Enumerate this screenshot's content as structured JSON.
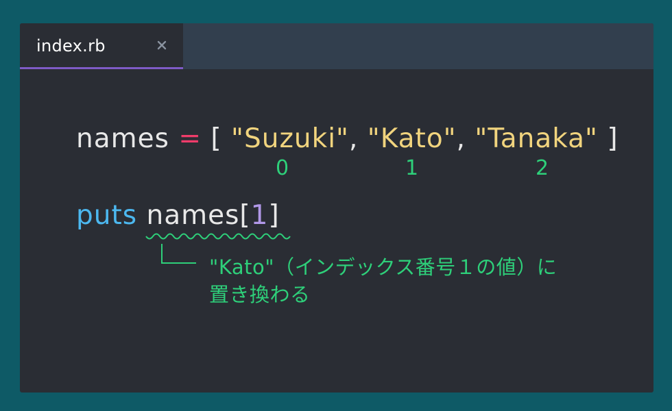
{
  "tab": {
    "title": "index.rb",
    "close_glyph": "×"
  },
  "code": {
    "line1": {
      "var": "names",
      "op": " = ",
      "open": "[ ",
      "str1": "\"Suzuki\"",
      "comma1": ", ",
      "str2": "\"Kato\"",
      "comma2": ", ",
      "str3": "\"Tanaka\"",
      "close": " ]"
    },
    "indices": [
      "0",
      "1",
      "2"
    ],
    "line2": {
      "keyword": "puts",
      "space": " ",
      "var": "names",
      "lbracket": "[",
      "index": "1",
      "rbracket": "]"
    }
  },
  "annotation": {
    "line1": "\"Kato\"（インデックス番号１の値）に",
    "line2": "置き換わる"
  },
  "colors": {
    "background": "#0e5a66",
    "editor": "#2a2d34",
    "tabbar": "#323f4e",
    "tab_underline": "#7e5bc7",
    "string": "#f1d47e",
    "operator": "#f03c6a",
    "keyword": "#4cb8f0",
    "number": "#b198e8",
    "annotation": "#2ed07a"
  }
}
